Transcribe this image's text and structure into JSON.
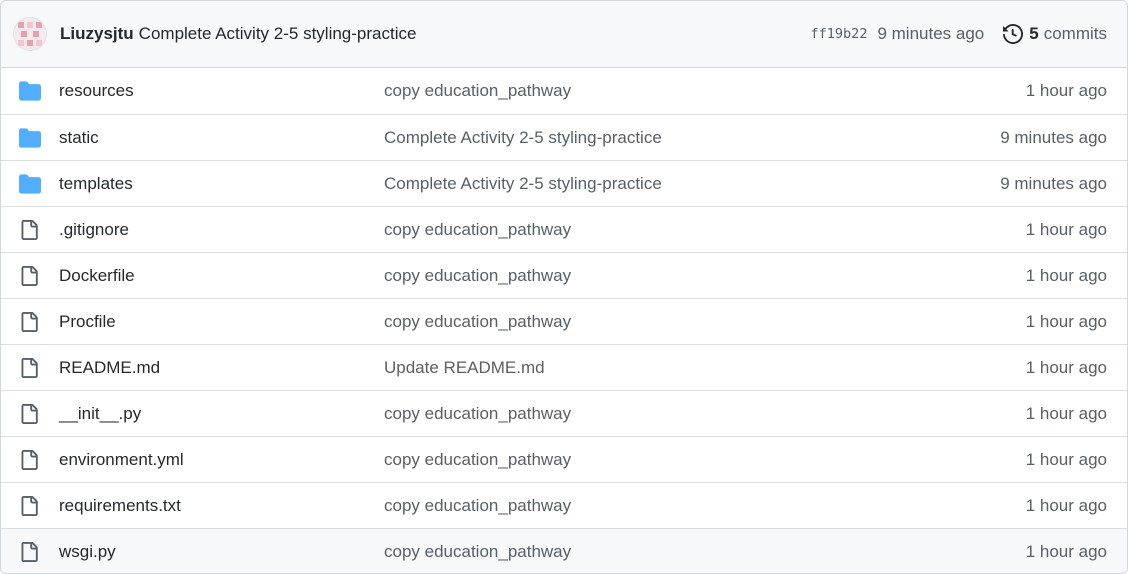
{
  "latest_commit": {
    "author": "Liuzysjtu",
    "message": "Complete Activity 2-5 styling-practice",
    "sha": "ff19b22",
    "time": "9 minutes ago",
    "commits_count": "5",
    "commits_label": "commits"
  },
  "files": [
    {
      "type": "folder",
      "icon": "folder-icon",
      "name": "resources",
      "message": "copy education_pathway",
      "age": "1 hour ago"
    },
    {
      "type": "folder",
      "icon": "folder-icon",
      "name": "static",
      "message": "Complete Activity 2-5 styling-practice",
      "age": "9 minutes ago"
    },
    {
      "type": "folder",
      "icon": "folder-icon",
      "name": "templates",
      "message": "Complete Activity 2-5 styling-practice",
      "age": "9 minutes ago"
    },
    {
      "type": "file",
      "icon": "file-icon",
      "name": ".gitignore",
      "message": "copy education_pathway",
      "age": "1 hour ago"
    },
    {
      "type": "file",
      "icon": "file-icon",
      "name": "Dockerfile",
      "message": "copy education_pathway",
      "age": "1 hour ago"
    },
    {
      "type": "file",
      "icon": "file-icon",
      "name": "Procfile",
      "message": "copy education_pathway",
      "age": "1 hour ago"
    },
    {
      "type": "file",
      "icon": "file-icon",
      "name": "README.md",
      "message": "Update README.md",
      "age": "1 hour ago"
    },
    {
      "type": "file",
      "icon": "file-icon",
      "name": "__init__.py",
      "message": "copy education_pathway",
      "age": "1 hour ago"
    },
    {
      "type": "file",
      "icon": "file-icon",
      "name": "environment.yml",
      "message": "copy education_pathway",
      "age": "1 hour ago"
    },
    {
      "type": "file",
      "icon": "file-icon",
      "name": "requirements.txt",
      "message": "copy education_pathway",
      "age": "1 hour ago"
    },
    {
      "type": "file",
      "icon": "file-icon",
      "name": "wsgi.py",
      "message": "copy education_pathway",
      "age": "1 hour ago"
    }
  ],
  "colors": {
    "folder": "#54aeff",
    "file": "#57606a",
    "muted_text": "#57606a",
    "header_bg": "#f6f8fa",
    "border": "#d0d7de",
    "avatar_accent": "#e8a0b0"
  }
}
